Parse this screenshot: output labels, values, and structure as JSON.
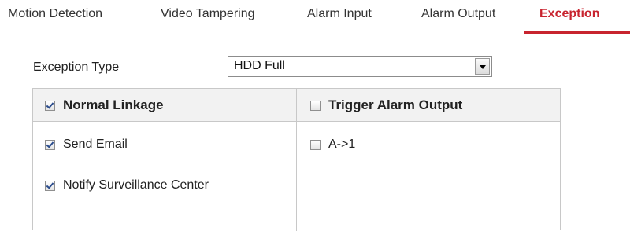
{
  "tabs": [
    {
      "label": "Motion Detection",
      "active": false
    },
    {
      "label": "Video Tampering",
      "active": false
    },
    {
      "label": "Alarm Input",
      "active": false
    },
    {
      "label": "Alarm Output",
      "active": false
    },
    {
      "label": "Exception",
      "active": true
    }
  ],
  "colors": {
    "accent": "#c8242f",
    "header_bg": "#f2f2f2",
    "border": "#c8c8c8"
  },
  "exception": {
    "label": "Exception Type",
    "selected": "HDD Full"
  },
  "linkage": {
    "left_header": {
      "label": "Normal Linkage",
      "checked": true
    },
    "right_header": {
      "label": "Trigger Alarm Output",
      "checked": false
    },
    "left_items": [
      {
        "label": "Send Email",
        "checked": true
      },
      {
        "label": "Notify Surveillance Center",
        "checked": true
      }
    ],
    "right_items": [
      {
        "label": "A->1",
        "checked": false
      }
    ]
  }
}
